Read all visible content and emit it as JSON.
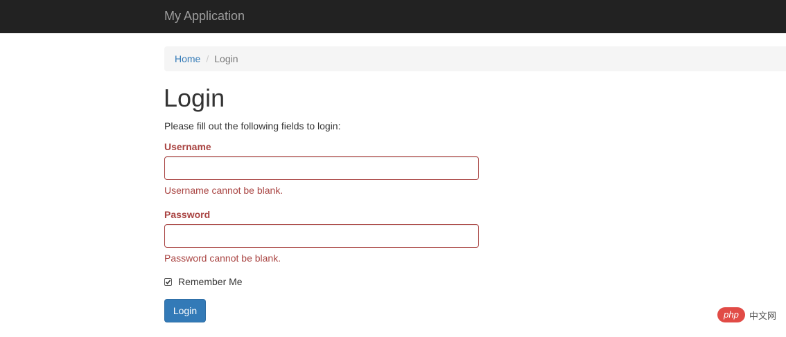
{
  "navbar": {
    "brand": "My Application"
  },
  "breadcrumb": {
    "home": "Home",
    "separator": "/",
    "current": "Login"
  },
  "page": {
    "title": "Login",
    "intro": "Please fill out the following fields to login:"
  },
  "form": {
    "username": {
      "label": "Username",
      "value": "",
      "error": "Username cannot be blank."
    },
    "password": {
      "label": "Password",
      "value": "",
      "error": "Password cannot be blank."
    },
    "remember": {
      "label": "Remember Me",
      "checked": true
    },
    "submit_label": "Login"
  },
  "watermark": {
    "logo": "php",
    "text": "中文网"
  },
  "colors": {
    "navbar_bg": "#222222",
    "brand_text": "#9d9d9d",
    "link": "#337ab7",
    "error": "#a94442",
    "primary_button": "#337ab7",
    "breadcrumb_bg": "#f5f5f5"
  }
}
